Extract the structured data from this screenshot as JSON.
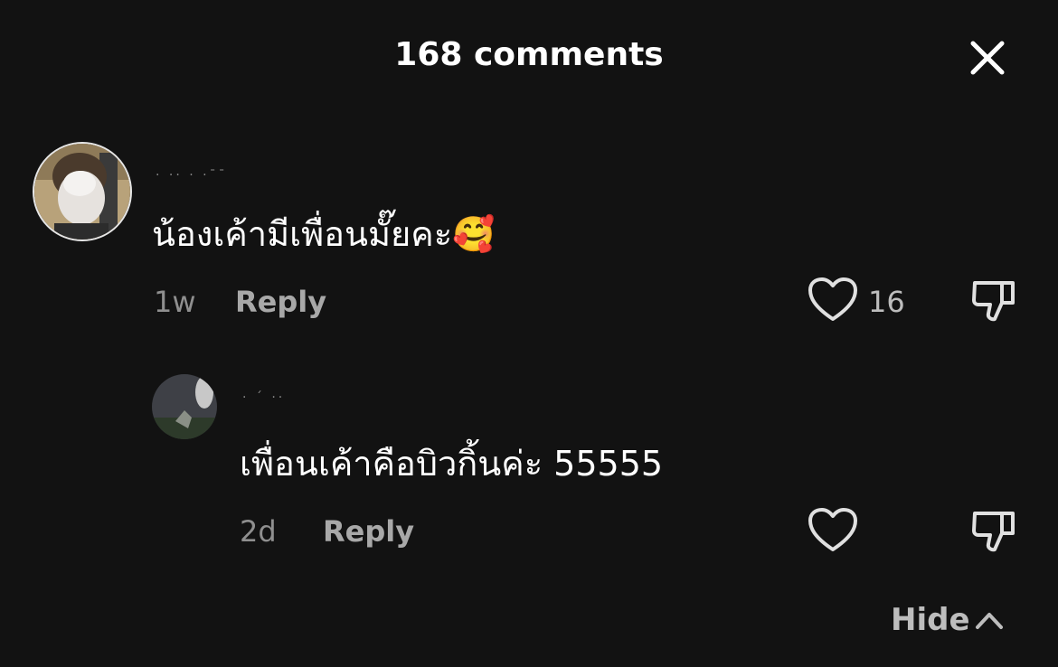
{
  "header": {
    "title": "168 comments"
  },
  "comments": [
    {
      "username": "· ·· · ·ˉˉ",
      "text": "น้องเค้ามีเพื่อนมั๊ยคะ🥰",
      "time": "1w",
      "reply_label": "Reply",
      "like_count": "16"
    },
    {
      "username": "· ´ ··",
      "text": "เพื่อนเค้าคือบิวกิ้นค่ะ 55555",
      "time": "2d",
      "reply_label": "Reply",
      "like_count": ""
    }
  ],
  "footer": {
    "hide_label": "Hide"
  },
  "icons": {
    "close": "close-icon",
    "like": "heart-outline-icon",
    "dislike": "thumbs-down-icon",
    "hide": "chevron-up-icon"
  },
  "colors": {
    "background": "#121212",
    "primary_text": "#ffffff",
    "secondary_text": "#a8a8a8"
  }
}
